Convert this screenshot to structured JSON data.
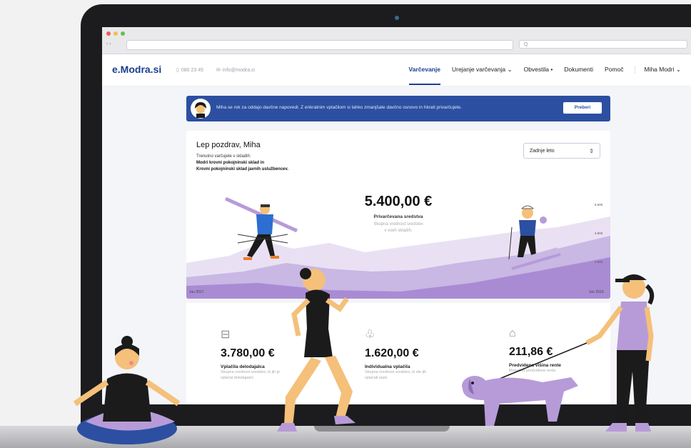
{
  "browser": {
    "search_placeholder": "Q",
    "nav_label": "‹ ›"
  },
  "logo": "e.Modra.si",
  "contact": {
    "phone": "080 23 45",
    "email": "info@modra.si"
  },
  "nav": {
    "items": [
      {
        "label": "Varčevanje",
        "active": true
      },
      {
        "label": "Urejanje varčevanja ⌄"
      },
      {
        "label": "Obvestila •"
      },
      {
        "label": "Dokumenti"
      },
      {
        "label": "Pomoč"
      },
      {
        "label": "Miha Modri ⌄"
      }
    ]
  },
  "banner": {
    "text": "Miha se rok za oddajo davčne napovedi. Z enkratnim vplačilom si lahko zmanjšate davčno osnovo in hkrati privarčujete.",
    "button": "Preberi"
  },
  "card": {
    "greeting": "Lep pozdrav, Miha",
    "intro": "Trenutno varčujete v skladih:",
    "fund1": "Modri krovni pokojninski sklad in",
    "fund2": "Krovni pokojninski sklad javnih uslužbencev.",
    "period": "Zadnje leto",
    "total": "5.400,00 €",
    "total_label": "Privarčevana sredstva",
    "total_sub1": "Skupna vrednost sredstev",
    "total_sub2": "v vseh skladih."
  },
  "chart_data": {
    "type": "area",
    "x_labels": [
      "Jun 2017",
      "Jun 2019"
    ],
    "y_ticks": [
      "5.600",
      "4.800",
      "3.600"
    ]
  },
  "stats": [
    {
      "icon": "briefcase-icon",
      "value": "3.780,00 €",
      "label": "Vplačila delodajalca",
      "sub": "Skupna vrednost sredstev, ki jih je vplačal delodajalec"
    },
    {
      "icon": "piggy-bank-icon",
      "value": "1.620,00 €",
      "label": "Individualna vplačila",
      "sub": "Skupna vrednost sredstev, ki ste jih vplačali sami"
    },
    {
      "icon": "bank-icon",
      "value": "211,86 €",
      "label": "Predvidena višina rente",
      "sub": "Mesečna predvidena renta"
    }
  ],
  "colors": {
    "brand": "#1a3e8f",
    "banner": "#2c4fa1",
    "accent": "#b79bd8"
  }
}
